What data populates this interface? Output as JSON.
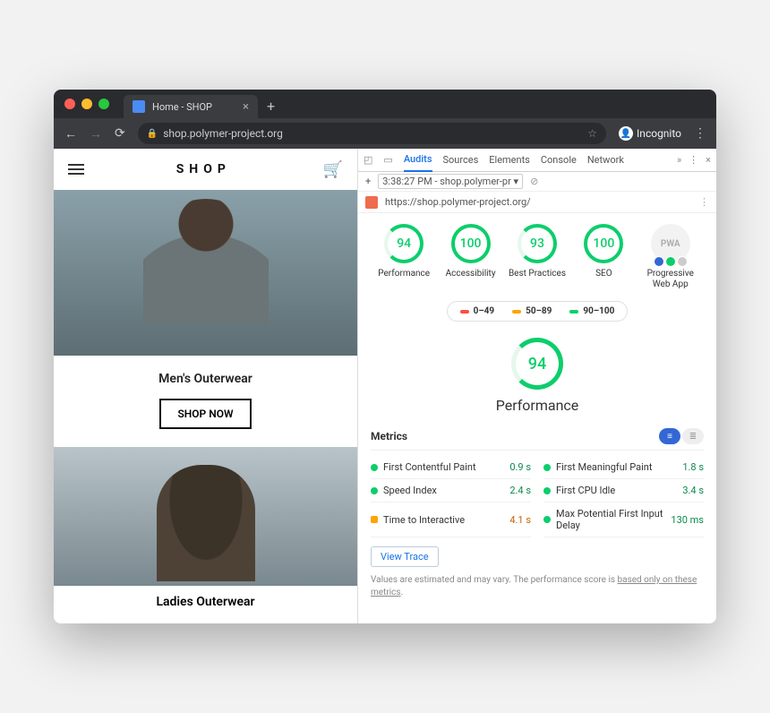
{
  "browser": {
    "tab_title": "Home - SHOP",
    "url_host": "shop.polymer-project.org",
    "incognito_label": "Incognito"
  },
  "page": {
    "brand": "SHOP",
    "section1_title": "Men's Outerwear",
    "shop_now": "SHOP NOW",
    "section2_title": "Ladies Outerwear"
  },
  "devtools": {
    "tabs": [
      "Audits",
      "Sources",
      "Elements",
      "Console",
      "Network"
    ],
    "dropdown": "3:38:27 PM - shop.polymer-pr",
    "url": "https://shop.polymer-project.org/",
    "gauges": [
      {
        "score": "94",
        "label": "Performance"
      },
      {
        "score": "100",
        "label": "Accessibility"
      },
      {
        "score": "93",
        "label": "Best Practices"
      },
      {
        "score": "100",
        "label": "SEO"
      }
    ],
    "pwa_label": "Progressive Web App",
    "pwa_short": "PWA",
    "legend": [
      {
        "range": "0–49",
        "color": "red"
      },
      {
        "range": "50–89",
        "color": "orange"
      },
      {
        "range": "90–100",
        "color": "green"
      }
    ],
    "big_score": "94",
    "big_label": "Performance",
    "metrics_title": "Metrics",
    "metrics": [
      {
        "name": "First Contentful Paint",
        "value": "0.9 s",
        "status": "green"
      },
      {
        "name": "First Meaningful Paint",
        "value": "1.8 s",
        "status": "green"
      },
      {
        "name": "Speed Index",
        "value": "2.4 s",
        "status": "green"
      },
      {
        "name": "First CPU Idle",
        "value": "3.4 s",
        "status": "green"
      },
      {
        "name": "Time to Interactive",
        "value": "4.1 s",
        "status": "orange"
      },
      {
        "name": "Max Potential First Input Delay",
        "value": "130 ms",
        "status": "green"
      }
    ],
    "view_trace": "View Trace",
    "footnote_a": "Values are estimated and may vary. The performance score is ",
    "footnote_b": "based only on these metrics",
    "footnote_c": "."
  }
}
